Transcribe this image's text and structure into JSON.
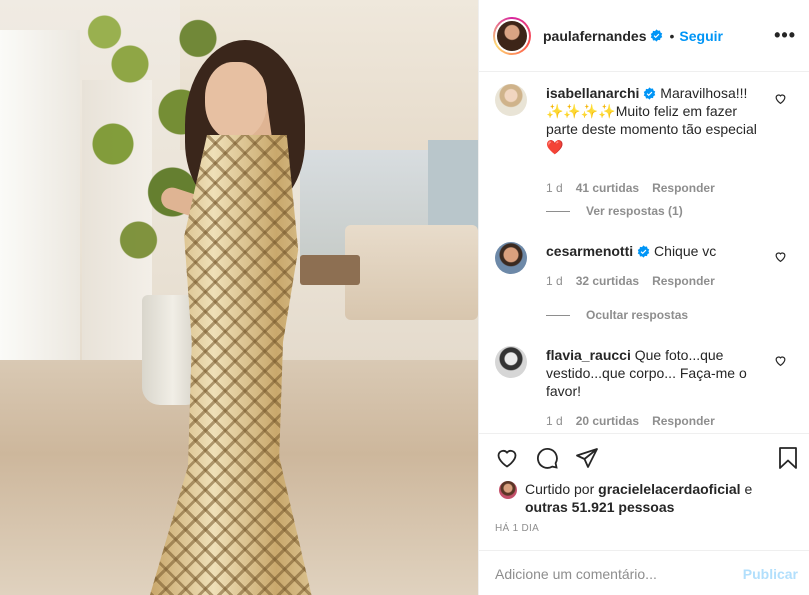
{
  "header": {
    "username": "paulafernandes",
    "dot": "•",
    "follow_label": "Seguir",
    "more_label": "•••"
  },
  "comments": [
    {
      "username": "isabellanarchi",
      "verified": true,
      "text": "Maravilhosa!!!✨✨✨✨Muito feliz em fazer parte deste momento tão especial❤️",
      "time": "1 d",
      "likes": "41 curtidas",
      "reply": "Responder",
      "replies_label": "Ver respostas (1)"
    },
    {
      "username": "cesarmenotti",
      "verified": true,
      "text": "Chique vc",
      "time": "1 d",
      "likes": "32 curtidas",
      "reply": "Responder",
      "replies_label": "Ocultar respostas"
    },
    {
      "username": "flavia_raucci",
      "verified": false,
      "text": "Que foto...que vestido...que corpo... Faça-me o favor!",
      "time": "1 d",
      "likes": "20 curtidas",
      "reply": "Responder"
    }
  ],
  "likes": {
    "prefix": "Curtido por",
    "user": "gracielelacerdaoficial",
    "conj": "e",
    "others": "outras 51.921 pessoas"
  },
  "time_ago": "HÁ 1 DIA",
  "add_comment": {
    "placeholder": "Adicione um comentário...",
    "post_label": "Publicar"
  },
  "colors": {
    "accent": "#0095f6",
    "post_disabled": "#b2dffc",
    "muted": "#8e8e8e",
    "text": "#262626"
  }
}
